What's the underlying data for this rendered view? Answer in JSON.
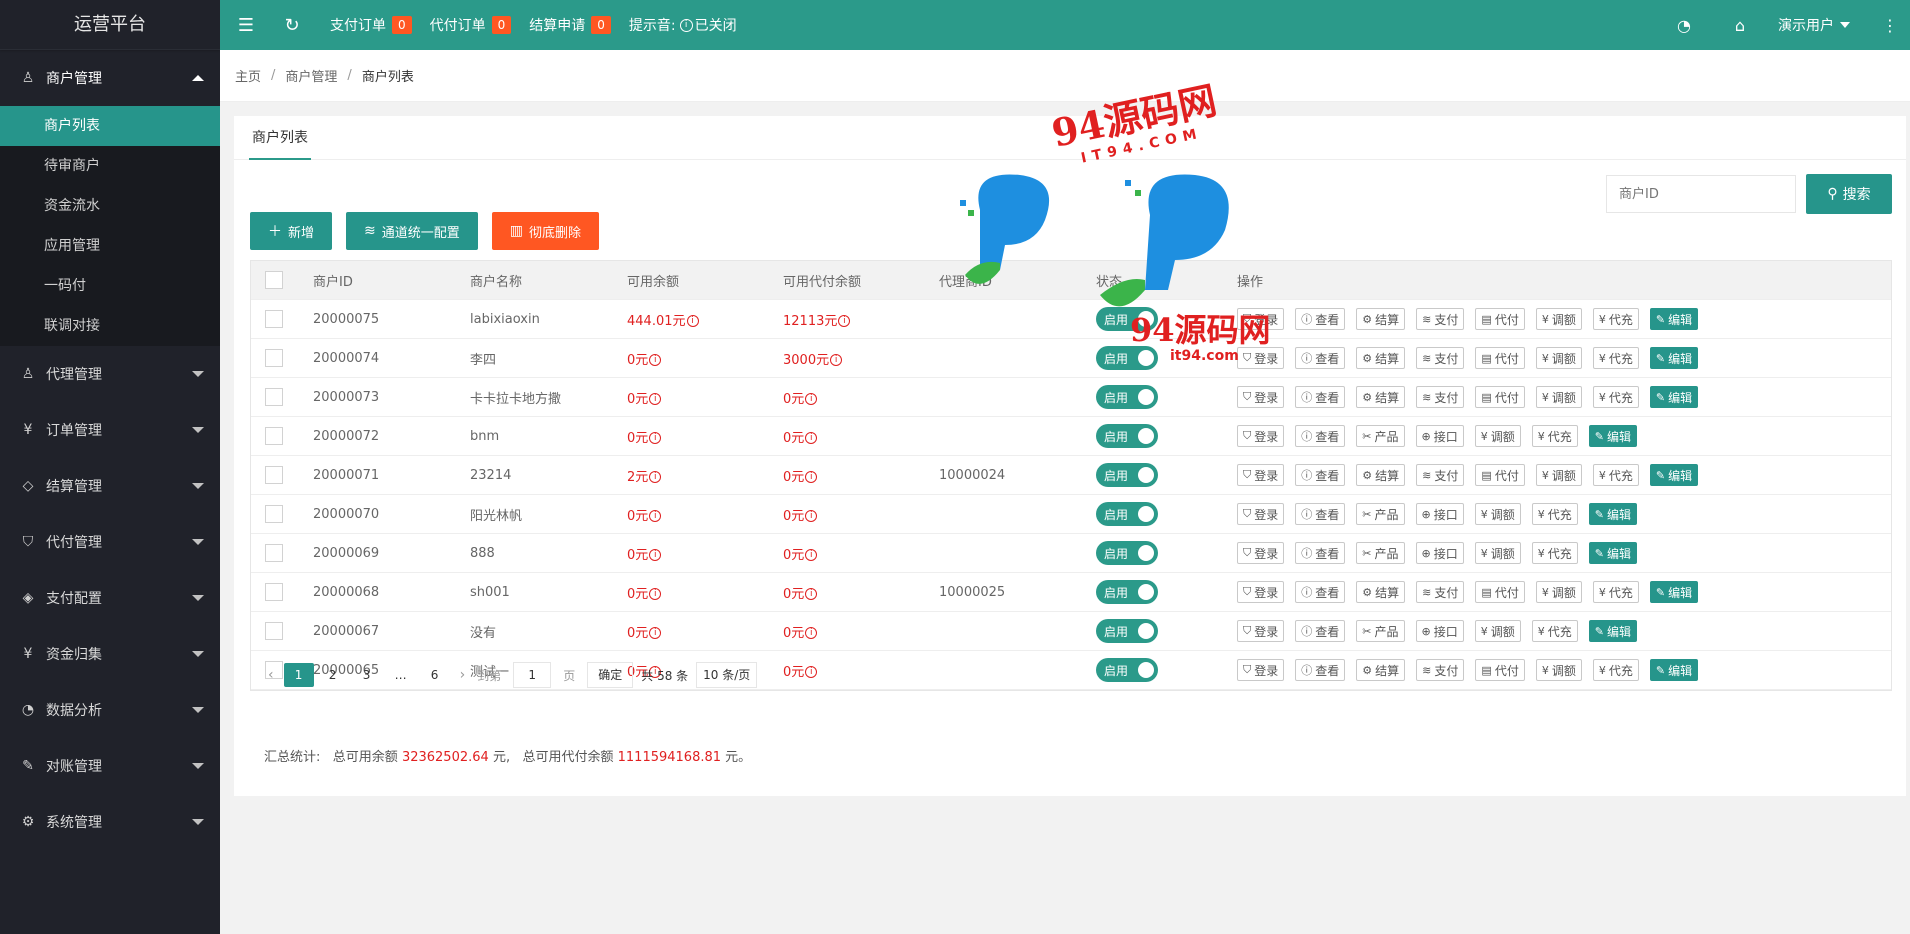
{
  "app": {
    "title": "运营平台"
  },
  "sidebar": {
    "groups": [
      {
        "label": "商户管理",
        "icon": "user-icon",
        "open": true,
        "items": [
          "商户列表",
          "待审商户",
          "资金流水",
          "应用管理",
          "一码付",
          "联调对接"
        ]
      },
      {
        "label": "代理管理",
        "icon": "person-icon"
      },
      {
        "label": "订单管理",
        "icon": "yen-icon"
      },
      {
        "label": "结算管理",
        "icon": "diamond-icon"
      },
      {
        "label": "代付管理",
        "icon": "shield-icon"
      },
      {
        "label": "支付配置",
        "icon": "cube-icon"
      },
      {
        "label": "资金归集",
        "icon": "yen-icon"
      },
      {
        "label": "数据分析",
        "icon": "gauge-icon"
      },
      {
        "label": "对账管理",
        "icon": "edit-icon"
      },
      {
        "label": "系统管理",
        "icon": "gear-icon"
      }
    ]
  },
  "header": {
    "pay_orders": "支付订单",
    "pay_orders_count": "0",
    "payout_orders": "代付订单",
    "payout_orders_count": "0",
    "settle_apply": "结算申请",
    "settle_apply_count": "0",
    "tone_label": "提示音:",
    "tone_status": "已关闭",
    "user": "演示用户"
  },
  "breadcrumb": {
    "home": "主页",
    "section": "商户管理",
    "current": "商户列表"
  },
  "tab": "商户列表",
  "search": {
    "placeholder": "商户ID",
    "button": "搜索"
  },
  "toolbar": {
    "add": "新增",
    "channel": "通道统一配置",
    "delete": "彻底删除"
  },
  "table": {
    "headers": [
      "商户ID",
      "商户名称",
      "可用余额",
      "可用代付余额",
      "代理商ID",
      "状态",
      "操作"
    ],
    "status_label": "启用",
    "rows": [
      {
        "id": "20000075",
        "name": "labixiaoxin",
        "bal": "444.01元",
        "dbal": "12113元",
        "agent": "",
        "ops": [
          "登录",
          "查看",
          "结算",
          "支付",
          "代付",
          "调额",
          "代充"
        ]
      },
      {
        "id": "20000074",
        "name": "李四",
        "bal": "0元",
        "dbal": "3000元",
        "agent": "",
        "ops": [
          "登录",
          "查看",
          "结算",
          "支付",
          "代付",
          "调额",
          "代充"
        ]
      },
      {
        "id": "20000073",
        "name": "卡卡拉卡地方撒",
        "bal": "0元",
        "dbal": "0元",
        "agent": "",
        "ops": [
          "登录",
          "查看",
          "结算",
          "支付",
          "代付",
          "调额",
          "代充"
        ]
      },
      {
        "id": "20000072",
        "name": "bnm",
        "bal": "0元",
        "dbal": "0元",
        "agent": "",
        "ops": [
          "登录",
          "查看",
          "产品",
          "接口",
          "调额",
          "代充"
        ]
      },
      {
        "id": "20000071",
        "name": "23214",
        "bal": "2元",
        "dbal": "0元",
        "agent": "10000024",
        "ops": [
          "登录",
          "查看",
          "结算",
          "支付",
          "代付",
          "调额",
          "代充"
        ]
      },
      {
        "id": "20000070",
        "name": "阳光林帆",
        "bal": "0元",
        "dbal": "0元",
        "agent": "",
        "ops": [
          "登录",
          "查看",
          "产品",
          "接口",
          "调额",
          "代充"
        ]
      },
      {
        "id": "20000069",
        "name": "888",
        "bal": "0元",
        "dbal": "0元",
        "agent": "",
        "ops": [
          "登录",
          "查看",
          "产品",
          "接口",
          "调额",
          "代充"
        ]
      },
      {
        "id": "20000068",
        "name": "sh001",
        "bal": "0元",
        "dbal": "0元",
        "agent": "10000025",
        "ops": [
          "登录",
          "查看",
          "结算",
          "支付",
          "代付",
          "调额",
          "代充"
        ]
      },
      {
        "id": "20000067",
        "name": "没有",
        "bal": "0元",
        "dbal": "0元",
        "agent": "",
        "ops": [
          "登录",
          "查看",
          "产品",
          "接口",
          "调额",
          "代充"
        ]
      },
      {
        "id": "20000065",
        "name": "测试一",
        "bal": "0元",
        "dbal": "0元",
        "agent": "",
        "ops": [
          "登录",
          "查看",
          "结算",
          "支付",
          "代付",
          "调额",
          "代充"
        ]
      }
    ],
    "edit_label": "编辑"
  },
  "pager": {
    "pages": [
      "1",
      "2",
      "3",
      "…",
      "6"
    ],
    "current": "1",
    "goto": "到第",
    "goto_value": "1",
    "page_unit": "页",
    "confirm": "确定",
    "total": "共 58 条",
    "per_page": "10 条/页"
  },
  "summary": {
    "label": "汇总统计:",
    "bal_label": "总可用余额",
    "bal_value": "32362502.64",
    "unit1": "元,",
    "dbal_label": "总可用代付余额",
    "dbal_value": "1111594168.81",
    "unit2": "元。"
  },
  "watermark": {
    "text1": "94源码网",
    "text2": "IT94.COM",
    "text3": "94源码网",
    "text4": "it94.com"
  },
  "colors": {
    "primary": "#26958b",
    "header": "#2b9a8a",
    "danger": "#ff5722",
    "sidebar": "#20222a",
    "amount": "#e02020"
  }
}
